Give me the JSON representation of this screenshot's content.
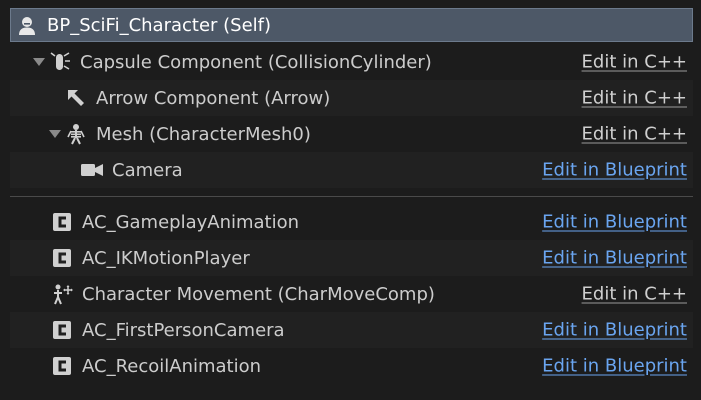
{
  "root": {
    "label": "BP_SciFi_Character (Self)",
    "icon": "character-icon"
  },
  "tree": [
    {
      "label": "Capsule Component (CollisionCylinder)",
      "icon": "capsule-icon",
      "expanded": true,
      "action": "Edit in C++"
    },
    {
      "label": "Arrow Component (Arrow)",
      "icon": "arrow-component-icon",
      "action": "Edit in C++"
    },
    {
      "label": "Mesh (CharacterMesh0)",
      "icon": "skeleton-icon",
      "expanded": true,
      "action": "Edit in C++"
    },
    {
      "label": "Camera",
      "icon": "camera-icon",
      "action": "Edit in Blueprint"
    }
  ],
  "components": [
    {
      "label": "AC_GameplayAnimation",
      "icon": "actor-component-icon",
      "action": "Edit in Blueprint"
    },
    {
      "label": "AC_IKMotionPlayer",
      "icon": "actor-component-icon",
      "action": "Edit in Blueprint"
    },
    {
      "label": "Character Movement (CharMoveComp)",
      "icon": "character-movement-icon",
      "action": "Edit in C++"
    },
    {
      "label": "AC_FirstPersonCamera",
      "icon": "actor-component-icon",
      "action": "Edit in Blueprint"
    },
    {
      "label": "AC_RecoilAnimation",
      "icon": "actor-component-icon",
      "action": "Edit in Blueprint"
    }
  ],
  "colors": {
    "root_bg": "#4d5867",
    "blueprint_link": "#6aa5f0",
    "cpp_link": "#cfcfcf"
  }
}
